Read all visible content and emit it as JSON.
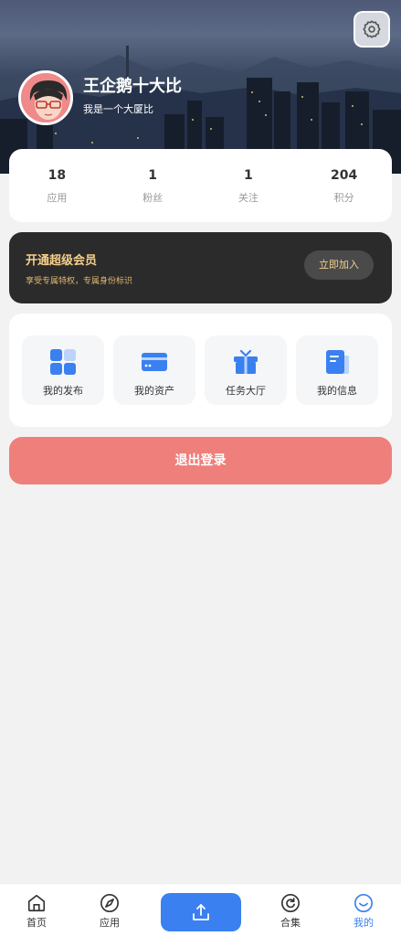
{
  "profile": {
    "username": "王企鹅十大比",
    "bio": "我是一个大厦比"
  },
  "stats": [
    {
      "value": "18",
      "label": "应用"
    },
    {
      "value": "1",
      "label": "粉丝"
    },
    {
      "value": "1",
      "label": "关注"
    },
    {
      "value": "204",
      "label": "积分"
    }
  ],
  "vip": {
    "title": "开通超级会员",
    "subtitle": "享受专属特权，专属身份标识",
    "button_label": "立即加入"
  },
  "menu": [
    {
      "label": "我的发布",
      "icon": "grid-icon"
    },
    {
      "label": "我的资产",
      "icon": "card-icon"
    },
    {
      "label": "任务大厅",
      "icon": "gift-icon"
    },
    {
      "label": "我的信息",
      "icon": "document-icon"
    }
  ],
  "logout_label": "退出登录",
  "tabbar": [
    {
      "label": "首页",
      "icon": "home-icon"
    },
    {
      "label": "应用",
      "icon": "compass-icon"
    },
    {
      "label": "",
      "icon": "upload-icon"
    },
    {
      "label": "合集",
      "icon": "refresh-icon"
    },
    {
      "label": "我的",
      "icon": "smile-icon",
      "active": true
    }
  ],
  "colors": {
    "accent": "#3a80f0",
    "logout": "#ee7f7b",
    "vip_bg": "#2b2b2b",
    "vip_gold": "#f5d08a",
    "page_bg": "#f2f2f2"
  }
}
